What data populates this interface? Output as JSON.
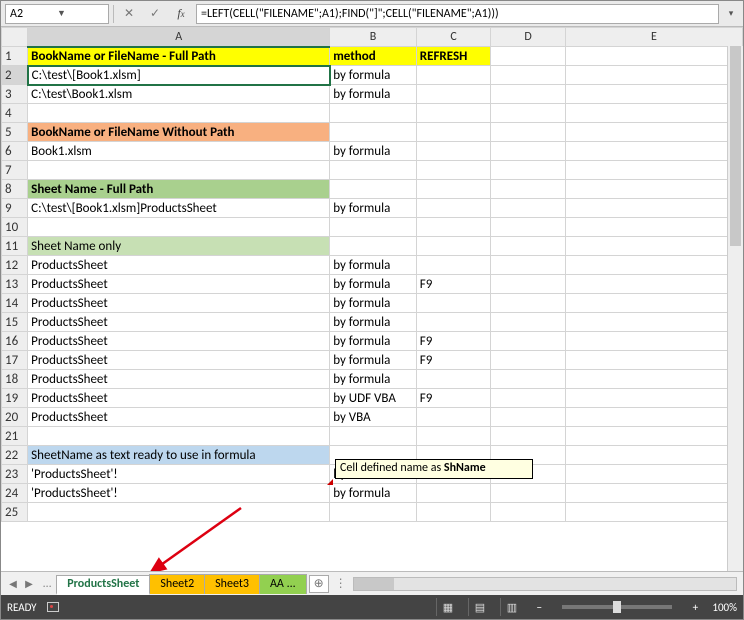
{
  "namebox": "A2",
  "formula": "=LEFT(CELL(\"FILENAME\";A1);FIND(\"]\";CELL(\"FILENAME\";A1)))",
  "columns": [
    "A",
    "B",
    "C",
    "D",
    "E"
  ],
  "header_row": {
    "A": "BookName or FileName - Full Path",
    "B": "method",
    "C": "REFRESH"
  },
  "rows": [
    {
      "n": 1,
      "A": "BookName or FileName - Full Path",
      "B": "method",
      "C": "REFRESH",
      "style": "hdr-yellow",
      "Bstyle": "hdr-yellow",
      "Cstyle": "hdr-yellow",
      "center": true
    },
    {
      "n": 2,
      "A": "C:\\test\\[Book1.xlsm]",
      "B": "by formula",
      "active": true
    },
    {
      "n": 3,
      "A": "C:\\test\\Book1.xlsm",
      "B": "by formula"
    },
    {
      "n": 4
    },
    {
      "n": 5,
      "A": "BookName or FileName  Without Path",
      "style": "hdr-orange"
    },
    {
      "n": 6,
      "A": "Book1.xlsm",
      "B": "by formula"
    },
    {
      "n": 7
    },
    {
      "n": 8,
      "A": "Sheet Name - Full Path",
      "style": "hdr-green"
    },
    {
      "n": 9,
      "A": "C:\\test\\[Book1.xlsm]ProductsSheet",
      "B": "by formula"
    },
    {
      "n": 10
    },
    {
      "n": 11,
      "A": "Sheet Name only",
      "style": "hdr-ltgreen"
    },
    {
      "n": 12,
      "A": "ProductsSheet",
      "B": "by formula"
    },
    {
      "n": 13,
      "A": "ProductsSheet",
      "B": "by formula",
      "C": "F9"
    },
    {
      "n": 14,
      "A": "ProductsSheet",
      "B": "by formula"
    },
    {
      "n": 15,
      "A": "ProductsSheet",
      "B": "by formula"
    },
    {
      "n": 16,
      "A": "ProductsSheet",
      "B": "by formula",
      "C": "F9"
    },
    {
      "n": 17,
      "A": "ProductsSheet",
      "B": "by formula",
      "C": "F9"
    },
    {
      "n": 18,
      "A": "ProductsSheet",
      "B": "by formula"
    },
    {
      "n": 19,
      "A": "ProductsSheet",
      "B": "by UDF VBA",
      "C": "F9"
    },
    {
      "n": 20,
      "A": "ProductsSheet",
      "B": "by VBA"
    },
    {
      "n": 21
    },
    {
      "n": 22,
      "A": "SheetName as text ready to use in formula",
      "style": "hdr-blue"
    },
    {
      "n": 23,
      "A": "'ProductsSheet'!",
      "B": "by formula"
    },
    {
      "n": 24,
      "A": "'ProductsSheet'!",
      "B": "by formula"
    },
    {
      "n": 25
    }
  ],
  "callout_prefix": "Cell defined name as ",
  "callout_bold": "ShName",
  "tabs": [
    {
      "label": "ProductsSheet",
      "cls": "active"
    },
    {
      "label": "Sheet2",
      "cls": "orange"
    },
    {
      "label": "Sheet3",
      "cls": "orange"
    },
    {
      "label": "AA ...",
      "cls": "green"
    }
  ],
  "status": {
    "ready": "READY",
    "zoom": "100%"
  }
}
